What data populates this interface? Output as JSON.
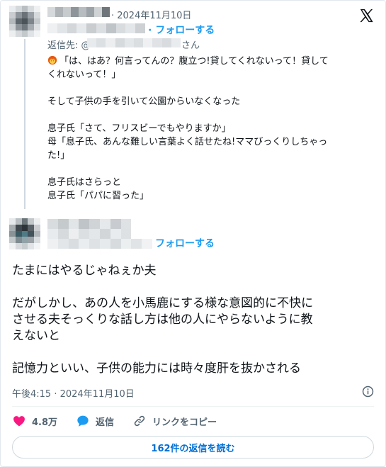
{
  "reply": {
    "date": "· 2024年11月10日",
    "follow_label": "· フォローする",
    "reply_to_label": "返信先: @",
    "reply_to_suffix": "さん",
    "lines": [
      "「は、はあ？何言ってんの？腹立つ!貸してくれないって！貸して",
      "くれないって！」",
      "",
      "そして子供の手を引いて公園からいなくなった",
      "",
      "息子氏「さて、フリスビーでもやりますか」",
      "母「息子氏、あんな難しい言葉よく話せたね!ママびっくりしちゃっ",
      "た!」",
      "",
      "息子氏はさらっと",
      "息子氏「パパに習った」"
    ]
  },
  "main": {
    "follow_label": "フォローする",
    "lines": [
      "たまにはやるじゃねぇか夫",
      "",
      "だがしかし、あの人を小馬鹿にする様な意図的に不快に",
      "させる夫そっくりな話し方は他の人にやらないように教",
      "えないと",
      "",
      "記憶力といい、子供の能力には時々度肝を抜かされる"
    ],
    "timestamp": "午後4:15 · 2024年11月10日",
    "like_count": "4.8万",
    "reply_label": "返信",
    "copy_link_label": "リンクをコピー",
    "read_replies_label": "162件の返信を読む"
  },
  "colors": {
    "accent": "#1d9bf0",
    "like": "#f91880",
    "muted": "#536471"
  },
  "icons": [
    "x-logo-icon",
    "woman-emoji-icon",
    "info-icon",
    "heart-icon",
    "reply-bubble-icon",
    "link-icon"
  ]
}
